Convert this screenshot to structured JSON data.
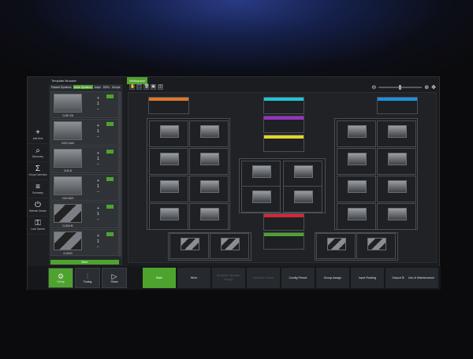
{
  "tools": [
    {
      "glyph": "+",
      "label": "Add Item",
      "icon": "add-icon"
    },
    {
      "glyph": "⌕",
      "label": "Discovery",
      "icon": "search-icon"
    },
    {
      "glyph": "Σ",
      "label": "Group Overview",
      "icon": "sum-icon"
    },
    {
      "glyph": "≡",
      "label": "Summary",
      "icon": "list-icon"
    },
    {
      "glyph": "⏻",
      "label": "Refresh Device",
      "icon": "power-icon"
    },
    {
      "glyph": "⚿",
      "label": "Lock Screen",
      "icon": "lock-icon"
    }
  ],
  "browser": {
    "title": "Template Browser",
    "tabs": [
      "Passive Speakers",
      "Active Speakers",
      "Amps",
      "DSPs",
      "Groups"
    ],
    "active_tab": 1,
    "items": [
      {
        "name": "CUBT-EB"
      },
      {
        "name": "CUBT-M&S"
      },
      {
        "name": "CUD-B"
      },
      {
        "name": "CUD-M&S"
      },
      {
        "name": "CUDAHD"
      },
      {
        "name": "CUDHD"
      }
    ],
    "more_label": "More"
  },
  "workspace": {
    "title": "Workspace"
  },
  "bottom": {
    "modes": [
      {
        "label": "Setup",
        "icon": "gear-icon",
        "glyph": "⚙"
      },
      {
        "label": "Tuning",
        "icon": "sliders-icon",
        "glyph": "⫶"
      },
      {
        "label": "Show",
        "icon": "play-icon",
        "glyph": "▷"
      }
    ],
    "views": [
      {
        "label": "Main",
        "state": "active"
      },
      {
        "label": "Wink",
        "state": "normal"
      },
      {
        "label": "Amplifier Speaker Assign",
        "state": "disabled"
      },
      {
        "label": "Amplifier Preset",
        "state": "disabled"
      },
      {
        "label": "Config Preset",
        "state": "normal"
      },
      {
        "label": "Group Assign",
        "state": "normal"
      },
      {
        "label": "Input Routing",
        "state": "normal"
      },
      {
        "label": "Output Routing",
        "state": "normal"
      },
      {
        "label": "Info & Maintenance",
        "state": "normal"
      }
    ]
  },
  "accent_color": "#4ea32f"
}
